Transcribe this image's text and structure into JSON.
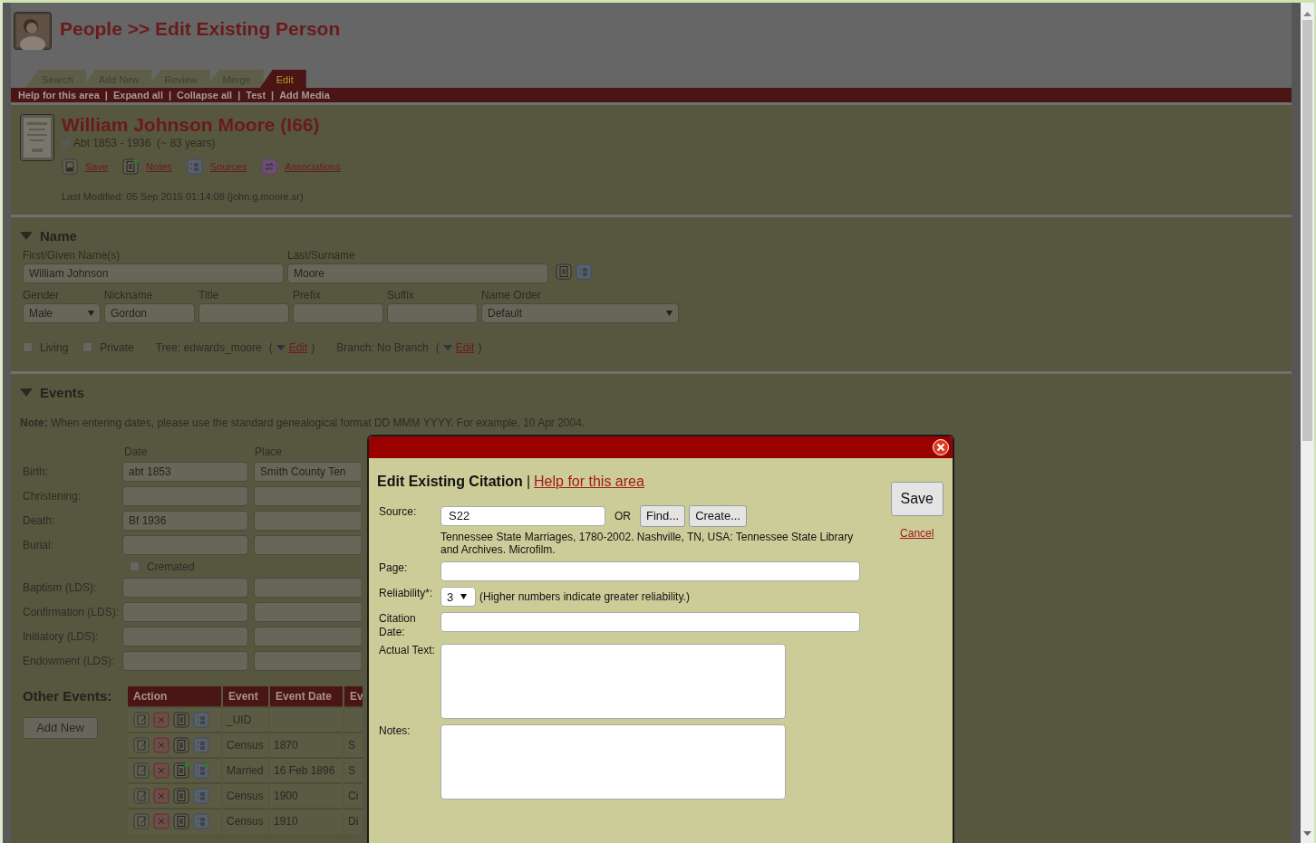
{
  "page_title": "People >> Edit Existing Person",
  "tabs": [
    {
      "label": "Search",
      "selected": false
    },
    {
      "label": "Add New",
      "selected": false
    },
    {
      "label": "Review",
      "selected": false
    },
    {
      "label": "Merge",
      "selected": false
    },
    {
      "label": "Edit",
      "selected": true
    }
  ],
  "subnav": {
    "separator": "|",
    "items": [
      "Help for this area",
      "Expand all",
      "Collapse all",
      "Test",
      "Add Media"
    ]
  },
  "person": {
    "name": "William Johnson Moore (I66)",
    "dates": "Abt 1853 - 1936  (~ 83 years)",
    "actions": [
      {
        "kind": "save",
        "label": "Save",
        "flagged": false
      },
      {
        "kind": "notes",
        "label": "Notes",
        "flagged": true
      },
      {
        "kind": "sources",
        "label": "Sources",
        "flagged": false
      },
      {
        "kind": "associations",
        "label": "Associations",
        "flagged": false
      }
    ],
    "last_modified": "Last Modified: 05 Sep 2015 01:14:08 (john.g.moore.sr)"
  },
  "name_section": {
    "title": "Name",
    "expanded": true,
    "first_label": "First/Given Name(s)",
    "first_value": "William Johnson",
    "last_label": "Last/Surname",
    "last_value": "Moore",
    "fields": [
      {
        "kind": "select",
        "label": "Gender",
        "value": "Male"
      },
      {
        "kind": "text",
        "label": "Nickname",
        "value": "Gordon"
      },
      {
        "kind": "text",
        "label": "Title"
      },
      {
        "kind": "text",
        "label": "Prefix"
      },
      {
        "kind": "text",
        "label": "Suffix"
      },
      {
        "kind": "select",
        "label": "Name Order",
        "value": "Default"
      }
    ],
    "flags": [
      {
        "label": "Living",
        "checked": false
      },
      {
        "label": "Private",
        "checked": false
      }
    ],
    "tree": {
      "text": "Tree: edwards_moore",
      "open": "(",
      "link": "Edit",
      "close": ")"
    },
    "branch": {
      "text": "Branch: No Branch",
      "open": "(",
      "link": "Edit",
      "close": ")"
    }
  },
  "events_section": {
    "title": "Events",
    "expanded": true,
    "note": "**Note:** When entering dates, please use the standard genealogical format DD MMM YYYY. For example, 10 Apr 2004.",
    "date_header": "Date",
    "place_header": "Place",
    "rows": [
      {
        "kind": "event",
        "label": "Birth:",
        "date": "abt 1853",
        "place": "Smith County Ten"
      },
      {
        "kind": "event",
        "label": "Christening:"
      },
      {
        "kind": "event",
        "label": "Death:",
        "date": "Bf 1936"
      },
      {
        "kind": "event",
        "label": "Burial:"
      },
      {
        "kind": "checkbox",
        "label": "Cremated",
        "checked": false
      },
      {
        "kind": "event",
        "label": "Baptism (LDS):"
      },
      {
        "kind": "event",
        "label": "Confirmation (LDS):"
      },
      {
        "kind": "event",
        "label": "Initiatory (LDS):"
      },
      {
        "kind": "event",
        "label": "Endowment (LDS):"
      }
    ]
  },
  "other_events": {
    "title": "Other Events:",
    "add_button": "Add New",
    "columns": [
      "Action",
      "Event",
      "Event Date",
      "Ev"
    ],
    "rows": [
      {
        "event": "_UID",
        "notes_flag": false,
        "sources_flag": false
      },
      {
        "event": "Census",
        "date": "1870",
        "column_4": "S",
        "notes_flag": false,
        "sources_flag": false
      },
      {
        "event": "Married",
        "date": "16 Feb 1896",
        "column_4": "S",
        "notes_flag": true,
        "sources_flag": true
      },
      {
        "event": "Census",
        "date": "1900",
        "column_4": "Ci",
        "notes_flag": false,
        "sources_flag": false
      },
      {
        "event": "Census",
        "date": "1910",
        "column_4": "Di",
        "notes_flag": false,
        "sources_flag": false
      }
    ]
  },
  "dialog": {
    "title": "Edit Existing Citation",
    "separator": "|",
    "help_link": "Help for this area",
    "save": "Save",
    "cancel": "Cancel",
    "source_label": "Source:",
    "source_value": "S22",
    "or": "OR",
    "find": "Find...",
    "create": "Create...",
    "source_description": "Tennessee State Marriages, 1780-2002. Nashville, TN, USA: Tennessee State Library and Archives. Microfilm.",
    "page_label": "Page:",
    "reliability_label": "Reliability*:",
    "reliability_value": "3",
    "reliability_hint": "(Higher numbers indicate greater reliability.)",
    "citation_date_label": "Citation Date:",
    "actual_text_label": "Actual Text:",
    "notes_label": "Notes:"
  }
}
